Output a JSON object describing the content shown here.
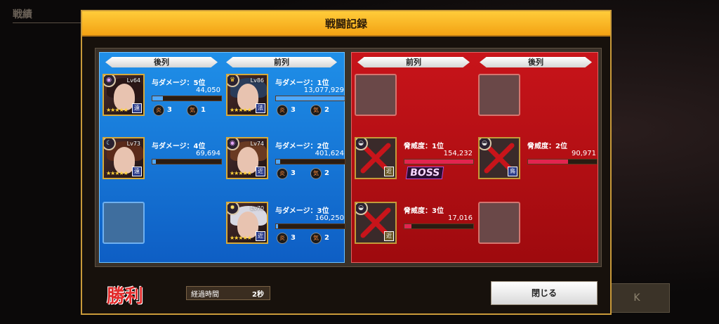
{
  "background": {
    "tab_label": "戦績",
    "button_fragment": "K"
  },
  "modal": {
    "title": "戦闘記録",
    "ally": {
      "rear_label": "後列",
      "front_label": "前列",
      "units": [
        {
          "lv": "Lv64",
          "stars": "★★★★★",
          "cls": "遠",
          "type_icon": "eye-icon",
          "stat": "与ダメージ：5位",
          "value": "44,050",
          "bar": 0.15,
          "stat1_icon": "炎",
          "stat1": "3",
          "stat2_icon": "気",
          "stat2": "1"
        },
        {
          "lv": "Lv86",
          "stars": "★★★★★",
          "cls": "法",
          "type_icon": "crown-icon",
          "stat": "与ダメージ：1位",
          "value": "13,077,929",
          "bar": 1.0,
          "stat1_icon": "炎",
          "stat1": "3",
          "stat2_icon": "気",
          "stat2": "2"
        },
        {
          "lv": "Lv73",
          "stars": "★★★★★",
          "cls": "遠",
          "type_icon": "moon-icon",
          "stat": "与ダメージ：4位",
          "value": "69,694",
          "bar": 0.05,
          "stat1_icon": "",
          "stat1": "",
          "stat2_icon": "",
          "stat2": ""
        },
        {
          "lv": "Lv74",
          "stars": "★★★★★",
          "cls": "近",
          "type_icon": "eye-icon",
          "stat": "与ダメージ：2位",
          "value": "401,624",
          "bar": 0.06,
          "stat1_icon": "炎",
          "stat1": "3",
          "stat2_icon": "気",
          "stat2": "2"
        },
        {
          "lv": "Lv70",
          "stars": "★★★★★",
          "cls": "近",
          "type_icon": "sun-icon",
          "stat": "与ダメージ：3位",
          "value": "160,250",
          "bar": 0.03,
          "stat1_icon": "炎",
          "stat1": "3",
          "stat2_icon": "気",
          "stat2": "2"
        }
      ]
    },
    "enemy": {
      "front_label": "前列",
      "rear_label": "後列",
      "units": [
        {
          "stat": "脅威度：1位",
          "value": "154,232",
          "bar": 1.0,
          "cls": "近",
          "boss": "BOSS"
        },
        {
          "stat": "脅威度：2位",
          "value": "90,971",
          "bar": 0.58,
          "cls": "鳥",
          "boss": ""
        },
        {
          "stat": "脅威度：3位",
          "value": "17,016",
          "bar": 0.1,
          "cls": "近",
          "boss": ""
        }
      ]
    },
    "result": "勝利",
    "elapsed_label": "経過時間",
    "elapsed_value": "2秒",
    "close_label": "閉じる"
  },
  "colors": {
    "ally_bar": "#4fa8ff",
    "enemy_bar": "#e3244f",
    "header": "#f3a213"
  }
}
